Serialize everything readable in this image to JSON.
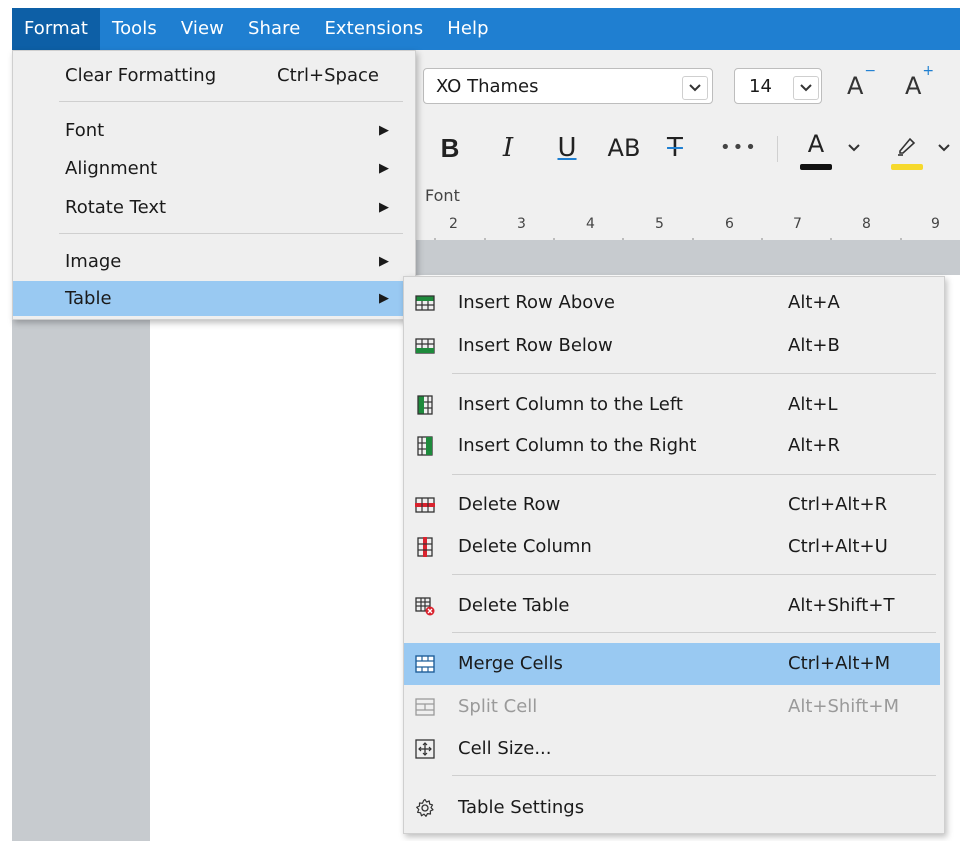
{
  "menubar": {
    "items": [
      "Format",
      "Tools",
      "View",
      "Share",
      "Extensions",
      "Help"
    ]
  },
  "toolbar": {
    "font_name": "XO Thames",
    "font_size": "14",
    "shrink_label": "A",
    "grow_label": "A",
    "bold": "B",
    "italic": "I",
    "underline": "U",
    "caps": "AB",
    "strike": "T",
    "more": "•••",
    "font_color_label": "A",
    "group_label": "Font",
    "ruler_numbers": [
      "2",
      "3",
      "4",
      "5",
      "6",
      "7",
      "8",
      "9"
    ]
  },
  "format_menu": {
    "clear_formatting": "Clear Formatting",
    "clear_formatting_shortcut": "Ctrl+Space",
    "font": "Font",
    "alignment": "Alignment",
    "rotate_text": "Rotate Text",
    "image": "Image",
    "table": "Table"
  },
  "table_menu": {
    "insert_row_above": "Insert Row Above",
    "insert_row_above_shortcut": "Alt+A",
    "insert_row_below": "Insert Row Below",
    "insert_row_below_shortcut": "Alt+B",
    "insert_col_left": "Insert Column to the Left",
    "insert_col_left_shortcut": "Alt+L",
    "insert_col_right": "Insert Column to the Right",
    "insert_col_right_shortcut": "Alt+R",
    "delete_row": "Delete Row",
    "delete_row_shortcut": "Ctrl+Alt+R",
    "delete_column": "Delete Column",
    "delete_column_shortcut": "Ctrl+Alt+U",
    "delete_table": "Delete Table",
    "delete_table_shortcut": "Alt+Shift+T",
    "merge_cells": "Merge Cells",
    "merge_cells_shortcut": "Ctrl+Alt+M",
    "split_cell": "Split Cell",
    "split_cell_shortcut": "Alt+Shift+M",
    "cell_size": "Cell Size...",
    "table_settings": "Table Settings"
  },
  "colors": {
    "menubar": "#1f7fd1",
    "selected": "#99c9f2",
    "icon_green": "#1e8a3c",
    "icon_red": "#d9232e",
    "font_color_bar": "#111111",
    "highlight_bar": "#f6d92c"
  }
}
